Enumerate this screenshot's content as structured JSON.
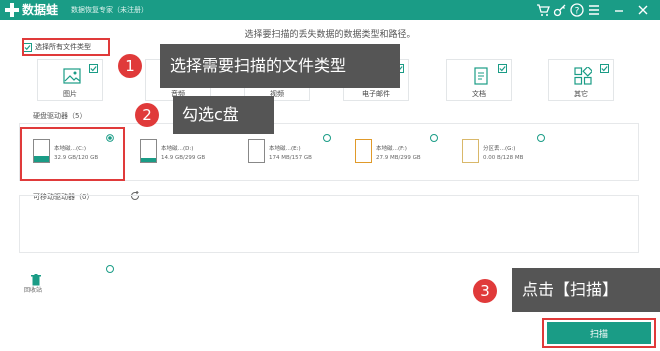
{
  "app": {
    "title": "数据蛙",
    "subtitle": "数据恢复专家（未注册）"
  },
  "headline": "选择要扫描的丢失数据的数据类型和路径。",
  "select_all": "选择所有文件类型",
  "file_types": [
    {
      "label": "图片",
      "icon": "image-icon",
      "checked": true
    },
    {
      "label": "音频",
      "icon": "audio-icon",
      "checked": true
    },
    {
      "label": "视频",
      "icon": "video-icon",
      "checked": true
    },
    {
      "label": "电子邮件",
      "icon": "email-icon",
      "checked": true
    },
    {
      "label": "文档",
      "icon": "document-icon",
      "checked": true
    },
    {
      "label": "其它",
      "icon": "other-icon",
      "checked": true
    }
  ],
  "drives_label": "硬盘驱动器（5）",
  "drives": [
    {
      "name": "本地磁…(C:)",
      "size": "32.9 GB/120 GB",
      "used_fraction": 0.27,
      "selected": true
    },
    {
      "name": "本地磁…(D:)",
      "size": "14.9 GB/299 GB",
      "used_fraction": 0.05,
      "selected": false
    },
    {
      "name": "本地磁…(E:)",
      "size": "174 MB/157 GB",
      "used_fraction": 0.0,
      "selected": false
    },
    {
      "name": "本地磁…(F:)",
      "size": "27.9 MB/299 GB",
      "used_fraction": 0.0,
      "selected": false
    },
    {
      "name": "分区丢…(G:)",
      "size": "0.00 B/128 MB",
      "used_fraction": 0.0,
      "selected": false
    }
  ],
  "removable_label": "可移动驱动器（0）",
  "recycle_label": "回收站",
  "scan_button": "扫描",
  "callouts": [
    {
      "num": "1",
      "text": "选择需要扫描的文件类型"
    },
    {
      "num": "2",
      "text": "勾选c盘"
    },
    {
      "num": "3",
      "text": "点击【扫描】"
    }
  ],
  "colors": {
    "accent": "#1a9c86",
    "callout_red": "#e03a3a",
    "callout_bg": "#555555"
  }
}
